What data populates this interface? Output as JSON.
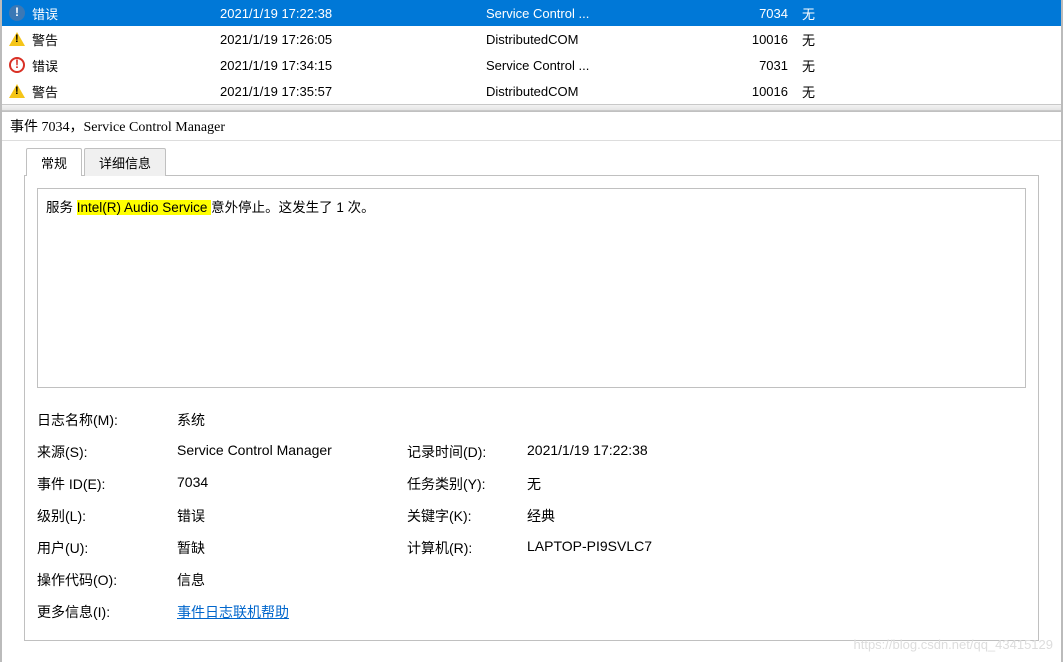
{
  "events": [
    {
      "icon": "info",
      "level": "错误",
      "date": "2021/1/19 17:22:38",
      "source": "Service Control ...",
      "id": "7034",
      "task": "无",
      "selected": true
    },
    {
      "icon": "warn",
      "level": "警告",
      "date": "2021/1/19 17:26:05",
      "source": "DistributedCOM",
      "id": "10016",
      "task": "无"
    },
    {
      "icon": "error",
      "level": "错误",
      "date": "2021/1/19 17:34:15",
      "source": "Service Control ...",
      "id": "7031",
      "task": "无"
    },
    {
      "icon": "warn",
      "level": "警告",
      "date": "2021/1/19 17:35:57",
      "source": "DistributedCOM",
      "id": "10016",
      "task": "无"
    }
  ],
  "detail": {
    "title": "事件 7034，Service Control Manager",
    "tabs": {
      "general": "常规",
      "details": "详细信息"
    },
    "description_pre": "服务 ",
    "description_hl": "Intel(R) Audio Service ",
    "description_post": "意外停止。这发生了 1 次。",
    "props": {
      "log_name_label": "日志名称(M):",
      "log_name": "系统",
      "source_label": "来源(S):",
      "source": "Service Control Manager",
      "logged_label": "记录时间(D):",
      "logged": "2021/1/19 17:22:38",
      "eventid_label": "事件 ID(E):",
      "eventid": "7034",
      "taskcat_label": "任务类别(Y):",
      "taskcat": "无",
      "level_label": "级别(L):",
      "level": "错误",
      "keywords_label": "关键字(K):",
      "keywords": "经典",
      "user_label": "用户(U):",
      "user": "暂缺",
      "computer_label": "计算机(R):",
      "computer": "LAPTOP-PI9SVLC7",
      "opcode_label": "操作代码(O):",
      "opcode": "信息",
      "moreinfo_label": "更多信息(I):",
      "moreinfo_link": "事件日志联机帮助"
    }
  },
  "watermark": "https://blog.csdn.net/qq_43415129"
}
